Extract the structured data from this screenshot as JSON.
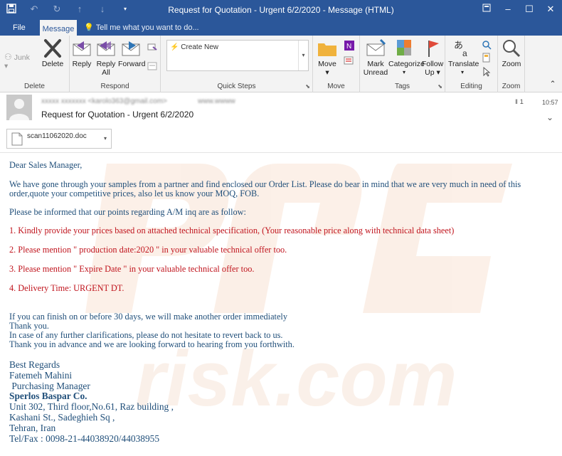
{
  "window": {
    "title": "Request for Quotation - Urgent 6/2/2020 - Message (HTML)"
  },
  "tabs": {
    "file": "File",
    "message": "Message",
    "tell_me": "Tell me what you want to do..."
  },
  "ribbon": {
    "delete_group": {
      "label": "Delete",
      "junk": "Junk",
      "delete": "Delete"
    },
    "respond_group": {
      "label": "Respond",
      "reply": "Reply",
      "reply_all_1": "Reply",
      "reply_all_2": "All",
      "forward": "Forward"
    },
    "quick_steps_group": {
      "label": "Quick Steps",
      "create_new": "Create New"
    },
    "move_group": {
      "label": "Move",
      "move": "Move"
    },
    "tags_group": {
      "label": "Tags",
      "mark_unread_1": "Mark",
      "mark_unread_2": "Unread",
      "categorize": "Categorize",
      "follow_up_1": "Follow",
      "follow_up_2": "Up"
    },
    "editing_group": {
      "label": "Editing",
      "translate": "Translate"
    },
    "zoom_group": {
      "label": "Zoom",
      "zoom": "Zoom"
    }
  },
  "message": {
    "from": "xxxxx xxxxxxx <karolo363@gmail.com>",
    "to": "www.wwww",
    "subject": "Request for Quotation - Urgent 6/2/2020",
    "count": "1",
    "time": "10:57",
    "attachment": "scan11062020.doc"
  },
  "body": {
    "greeting": "Dear Sales Manager,",
    "p1_l1": "We have gone through your samples from a partner and find enclosed our  Order List. Please do bear in mind that we are very much  in need of this",
    "p1_l2": "order,quote your competitive prices, also let us know your MOQ, FOB.",
    "p2": "Please be informed that our points regarding A/M inq are as follow:",
    "item1": "1. Kindly provide your prices based on attached technical specification, (Your reasonable price along with technical data sheet)",
    "item2": "2. Please mention \" production date:2020 \" in your valuable technical offer too.",
    "item3": "3. Please mention \" Expire Date \" in your valuable technical offer too.",
    "item4": "4. Delivery Time: URGENT DT.",
    "close1": "If you can finish on or before 30 days, we will make  another order immediately",
    "close2": "Thank you.",
    "close3": "In case of any further clarifications, please do not hesitate to revert back to us.",
    "close4": "Thank you in advance and we are looking forward to hearing from you forthwith."
  },
  "signature": {
    "regards": "Best Regards",
    "name": "Fatemeh Mahini",
    "title": " Purchasing Manager",
    "company": "Sperlos Baspar Co.",
    "addr1": "Unit 302, Third floor,No.61, Raz building ,",
    "addr2": "Kashani St., Sadeghieh Sq ,",
    "addr3": "Tehran, Iran",
    "tel": "Tel/Fax : 0098-21-44038920/44038955"
  },
  "colors": {
    "titlebar": "#2b579a",
    "body_text": "#1f4e79",
    "red_text": "#c0141d"
  }
}
